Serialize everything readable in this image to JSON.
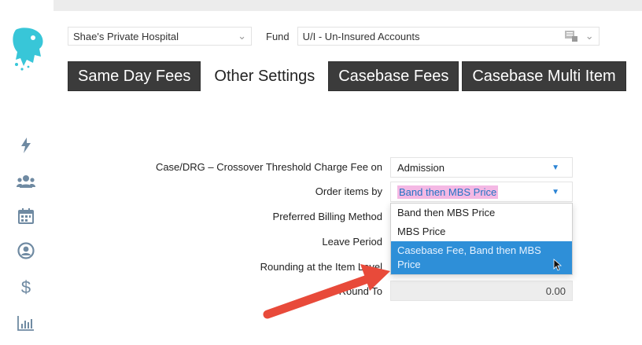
{
  "toolbar": {
    "hospital": "Shae's Private Hospital",
    "fund_label": "Fund",
    "fund": "U/I - Un-Insured Accounts"
  },
  "tabs": [
    {
      "label": "Same Day Fees"
    },
    {
      "label": "Other Settings"
    },
    {
      "label": "Casebase Fees"
    },
    {
      "label": "Casebase Multi Item"
    }
  ],
  "form": {
    "crossover_label": "Case/DRG – Crossover Threshold Charge Fee on",
    "crossover_value": "Admission",
    "order_label": "Order items by",
    "order_value": "Band then MBS Price",
    "billing_label": "Preferred Billing Method",
    "leave_label": "Leave Period",
    "rounding_label": "Rounding at the Item Level",
    "round_to_label": "Round To",
    "round_to_value": "0.00"
  },
  "dropdown": {
    "options": [
      "Band then MBS Price",
      "MBS Price",
      "Casebase Fee, Band then MBS Price"
    ]
  },
  "colors": {
    "accent": "#2e8fd8",
    "highlight": "#f4b8e4",
    "arrow": "#e84a3a",
    "tab_dark": "#3b3b3b",
    "logo": "#38c6d8"
  }
}
